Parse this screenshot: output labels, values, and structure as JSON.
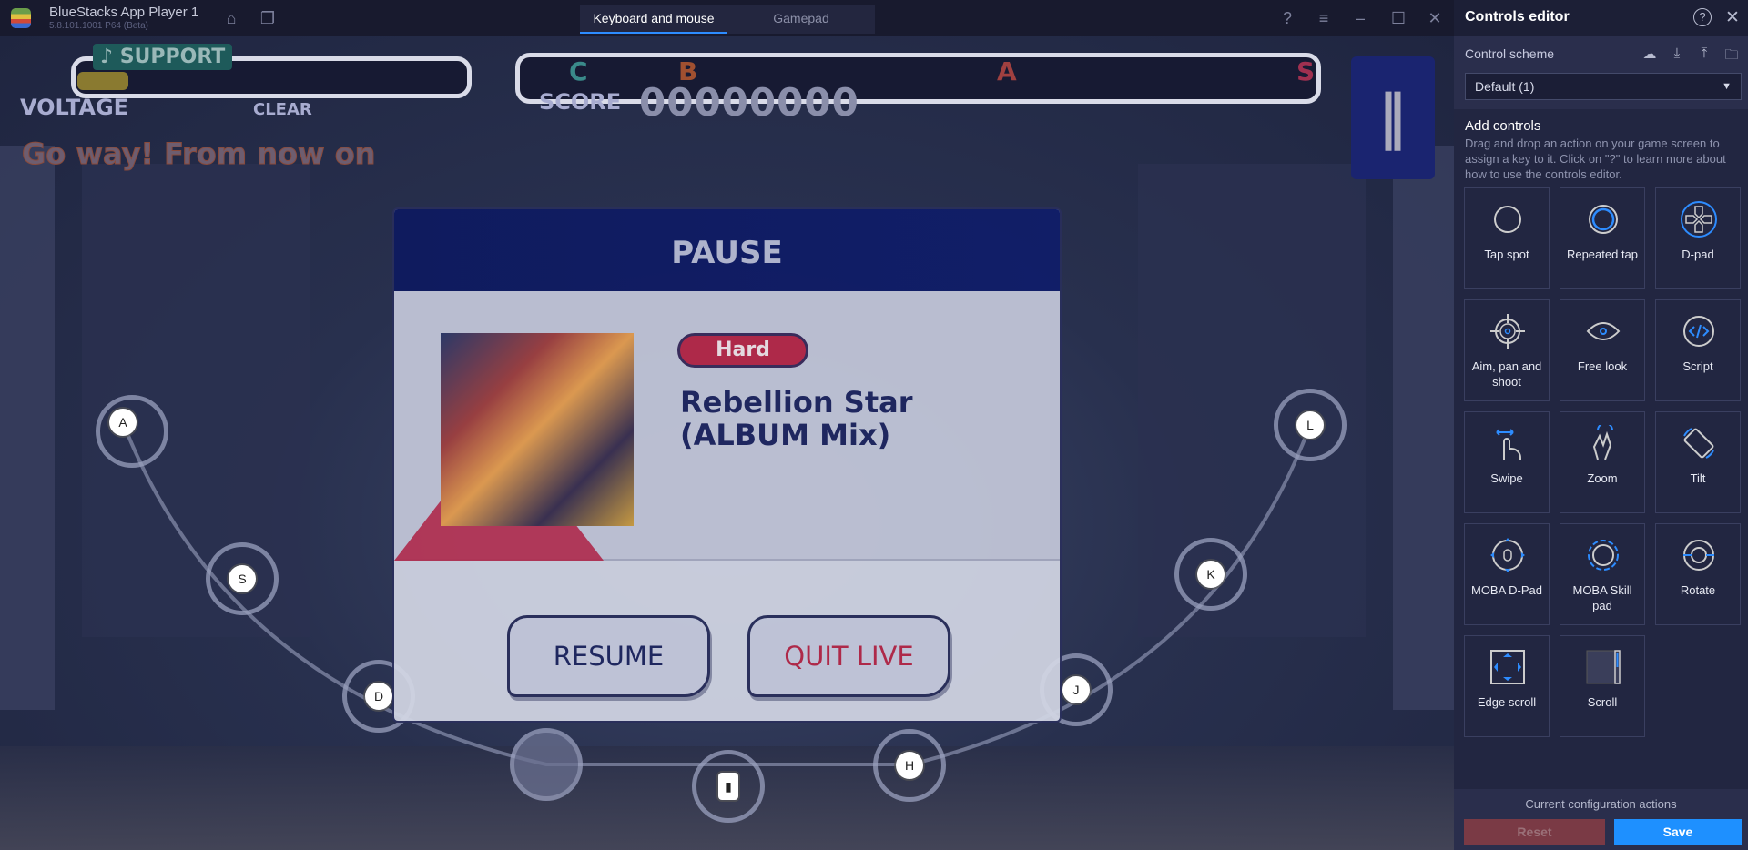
{
  "titlebar": {
    "app_name": "BlueStacks App Player 1",
    "version": "5.8.101.1001 P64 (Beta)",
    "tabs": [
      {
        "label": "Keyboard and mouse",
        "active": true
      },
      {
        "label": "Gamepad",
        "active": false
      }
    ]
  },
  "game": {
    "support": "♪ SUPPORT",
    "voltage": "VOLTAGE",
    "clear": "CLEAR",
    "score_label": "SCORE",
    "score": "00000000",
    "ranks": [
      "C",
      "B",
      "A",
      "S"
    ],
    "lyric": "Go way! From now on",
    "keys": [
      "A",
      "S",
      "D",
      "H",
      "J",
      "K",
      "L"
    ],
    "pause": {
      "title": "PAUSE",
      "difficulty": "Hard",
      "song": "Rebellion Star (ALBUM Mix)",
      "resume": "RESUME",
      "quit": "QUIT LIVE"
    }
  },
  "panel": {
    "title": "Controls editor",
    "scheme_label": "Control scheme",
    "scheme_value": "Default (1)",
    "add_title": "Add controls",
    "add_desc": "Drag and drop an action on your game screen to assign a key to it. Click on \"?\" to learn more about how to use the controls editor.",
    "controls": [
      {
        "label": "Tap spot",
        "icon": "tap-spot-icon"
      },
      {
        "label": "Repeated tap",
        "icon": "repeated-tap-icon"
      },
      {
        "label": "D-pad",
        "icon": "dpad-icon"
      },
      {
        "label": "Aim, pan and shoot",
        "icon": "crosshair-icon"
      },
      {
        "label": "Free look",
        "icon": "eye-icon"
      },
      {
        "label": "Script",
        "icon": "code-icon"
      },
      {
        "label": "Swipe",
        "icon": "swipe-hand-icon"
      },
      {
        "label": "Zoom",
        "icon": "pinch-icon"
      },
      {
        "label": "Tilt",
        "icon": "tilt-icon"
      },
      {
        "label": "MOBA D-Pad",
        "icon": "moba-dpad-icon"
      },
      {
        "label": "MOBA Skill pad",
        "icon": "moba-skill-icon"
      },
      {
        "label": "Rotate",
        "icon": "rotate-icon"
      },
      {
        "label": "Edge scroll",
        "icon": "edge-scroll-icon"
      },
      {
        "label": "Scroll",
        "icon": "scroll-icon"
      }
    ],
    "footer_label": "Current configuration actions",
    "reset": "Reset",
    "save": "Save"
  },
  "colors": {
    "accent": "#1e90ff",
    "reset": "#7a3a45",
    "hard": "#b82848"
  }
}
